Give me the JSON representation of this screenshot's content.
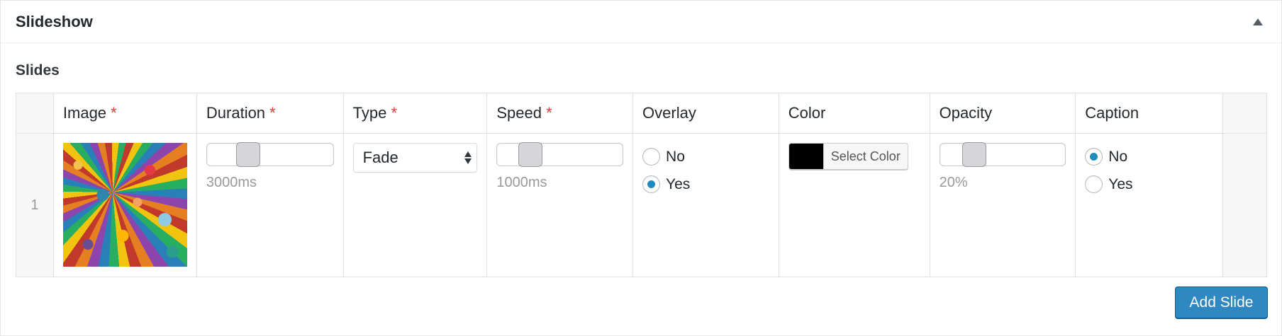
{
  "panel": {
    "title": "Slideshow"
  },
  "section": {
    "label": "Slides"
  },
  "table": {
    "columns": {
      "image": "Image",
      "duration": "Duration",
      "type": "Type",
      "speed": "Speed",
      "overlay": "Overlay",
      "color": "Color",
      "opacity": "Opacity",
      "caption": "Caption"
    },
    "required_marker": "*",
    "rows": [
      {
        "number": "1",
        "image_icon": "image-thumbnail",
        "duration": {
          "value_label": "3000ms",
          "slider_fraction": 0.22
        },
        "type": {
          "selected": "Fade"
        },
        "speed": {
          "value_label": "1000ms",
          "slider_fraction": 0.16
        },
        "overlay": {
          "options": [
            "No",
            "Yes"
          ],
          "selected": "Yes"
        },
        "color": {
          "button_label": "Select Color",
          "swatch": "#000000"
        },
        "opacity": {
          "value_label": "20%",
          "slider_fraction": 0.2
        },
        "caption": {
          "options": [
            "No",
            "Yes"
          ],
          "selected": "No"
        }
      }
    ]
  },
  "actions": {
    "add_slide": "Add Slide"
  },
  "colors": {
    "primary_button": "#2f88c2",
    "required": "#dd3d36",
    "radio_checked": "#1e8cbe"
  }
}
